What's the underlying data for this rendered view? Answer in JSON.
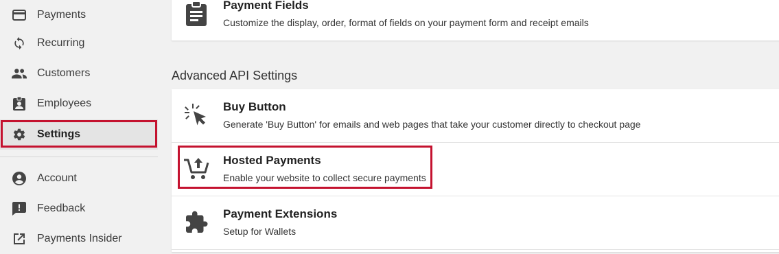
{
  "sidebar": {
    "items": [
      {
        "label": "Payments",
        "icon": "credit-card-icon"
      },
      {
        "label": "Recurring",
        "icon": "sync-icon"
      },
      {
        "label": "Customers",
        "icon": "people-icon"
      },
      {
        "label": "Employees",
        "icon": "badge-icon"
      },
      {
        "label": "Settings",
        "icon": "gear-icon",
        "active": true
      },
      {
        "label": "Account",
        "icon": "account-circle-icon"
      },
      {
        "label": "Feedback",
        "icon": "feedback-icon"
      },
      {
        "label": "Payments Insider",
        "icon": "external-link-icon"
      }
    ]
  },
  "main": {
    "top_card": {
      "title": "Payment Fields",
      "description": "Customize the display, order, format of fields on your payment form and receipt emails",
      "icon": "clipboard-icon"
    },
    "section_title": "Advanced API Settings",
    "rows": [
      {
        "title": "Buy Button",
        "description": "Generate 'Buy Button' for emails and web pages that take your customer directly to checkout page",
        "icon": "click-cursor-icon"
      },
      {
        "title": "Hosted Payments",
        "description": "Enable your website to collect secure payments",
        "icon": "cart-upload-icon"
      },
      {
        "title": "Payment Extensions",
        "description": "Setup for Wallets",
        "icon": "puzzle-icon"
      }
    ]
  },
  "colors": {
    "highlight": "#c4122f",
    "icon": "#444444"
  }
}
